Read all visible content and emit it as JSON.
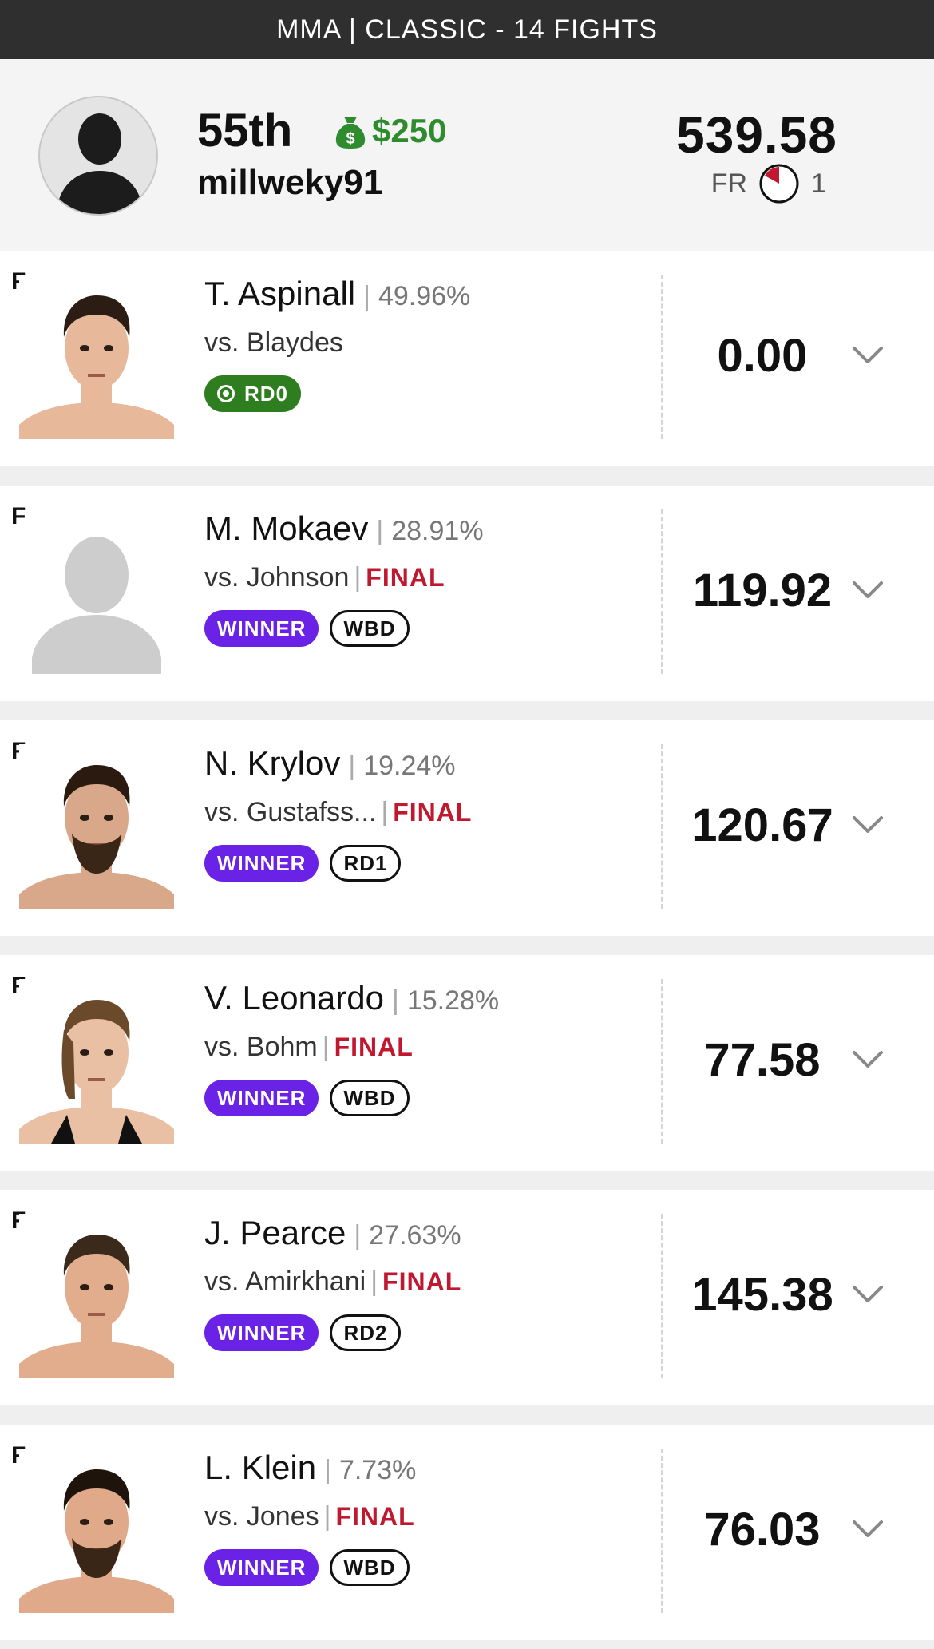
{
  "header": {
    "title": "MMA | CLASSIC - 14 FIGHTS"
  },
  "entry": {
    "rank": "55th",
    "prize": "$250",
    "username": "millweky91",
    "total_points": "539.58",
    "fr_label": "FR",
    "fr_count": "1"
  },
  "colors": {
    "winner": "#6a23e6",
    "final": "#c0182e",
    "prize": "#2e8b2e",
    "live": "#2e7d1f"
  },
  "fighters": [
    {
      "flag": "F",
      "name": "T. Aspinall",
      "pct": "49.96%",
      "opponent": "vs. Blaydes",
      "status": "",
      "badge_live": "RD0",
      "badge_winner": "",
      "badge_method": "",
      "score": "0.00",
      "photo": "fighter-photo"
    },
    {
      "flag": "F",
      "name": "M. Mokaev",
      "pct": "28.91%",
      "opponent": "vs. Johnson",
      "status": "FINAL",
      "badge_live": "",
      "badge_winner": "WINNER",
      "badge_method": "WBD",
      "score": "119.92",
      "photo": "placeholder-silhouette"
    },
    {
      "flag": "F",
      "name": "N. Krylov",
      "pct": "19.24%",
      "opponent": "vs. Gustafss...",
      "status": "FINAL",
      "badge_live": "",
      "badge_winner": "WINNER",
      "badge_method": "RD1",
      "score": "120.67",
      "photo": "fighter-photo"
    },
    {
      "flag": "F",
      "name": "V. Leonardo",
      "pct": "15.28%",
      "opponent": "vs. Bohm",
      "status": "FINAL",
      "badge_live": "",
      "badge_winner": "WINNER",
      "badge_method": "WBD",
      "score": "77.58",
      "photo": "fighter-photo"
    },
    {
      "flag": "F",
      "name": "J. Pearce",
      "pct": "27.63%",
      "opponent": "vs. Amirkhani",
      "status": "FINAL",
      "badge_live": "",
      "badge_winner": "WINNER",
      "badge_method": "RD2",
      "score": "145.38",
      "photo": "fighter-photo"
    },
    {
      "flag": "F",
      "name": "L. Klein",
      "pct": "7.73%",
      "opponent": "vs. Jones",
      "status": "FINAL",
      "badge_live": "",
      "badge_winner": "WINNER",
      "badge_method": "WBD",
      "score": "76.03",
      "photo": "fighter-photo"
    }
  ]
}
